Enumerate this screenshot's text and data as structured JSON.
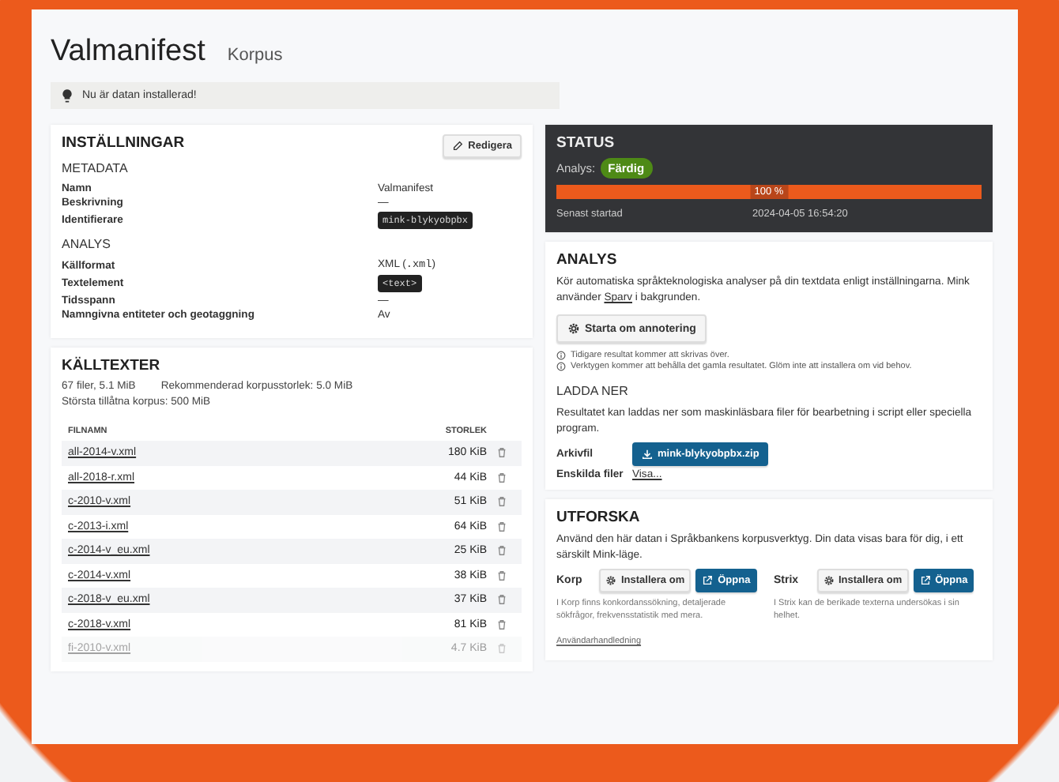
{
  "page": {
    "title": "Valmanifest",
    "subtitle": "Korpus"
  },
  "notice": "Nu är datan installerad!",
  "settings": {
    "title": "INSTÄLLNINGAR",
    "edit_button": "Redigera",
    "sections": [
      {
        "heading": "METADATA",
        "rows": [
          {
            "label": "Namn",
            "parts": [
              {
                "kind": "text",
                "text": "Valmanifest"
              }
            ]
          },
          {
            "label": "Beskrivning",
            "parts": [
              {
                "kind": "text",
                "text": "—"
              }
            ]
          },
          {
            "label": "Identifierare",
            "parts": [
              {
                "kind": "tag",
                "text": "mink-blykyobpbx"
              }
            ]
          }
        ]
      },
      {
        "heading": "ANALYS",
        "rows": [
          {
            "label": "Källformat",
            "parts": [
              {
                "kind": "text",
                "text": "XML ("
              },
              {
                "kind": "code",
                "text": ".xml"
              },
              {
                "kind": "text",
                "text": ")"
              }
            ]
          },
          {
            "label": "Textelement",
            "parts": [
              {
                "kind": "tag",
                "text": "<text>"
              }
            ]
          },
          {
            "label": "Tidsspann",
            "parts": [
              {
                "kind": "text",
                "text": "—"
              }
            ]
          },
          {
            "label": "Namngivna entiteter och geotaggning",
            "parts": [
              {
                "kind": "text",
                "text": "Av"
              }
            ]
          }
        ]
      }
    ]
  },
  "sources": {
    "title": "KÄLLTEXTER",
    "file_count": "67 filer, 5.1 MiB",
    "recommended": "Rekommenderad korpusstorlek: 5.0 MiB",
    "max": "Största tillåtna korpus: 500 MiB",
    "columns": [
      "FILNAMN",
      "STORLEK"
    ],
    "files": [
      {
        "name": "all-2014-v.xml",
        "size": "180 KiB"
      },
      {
        "name": "all-2018-r.xml",
        "size": "44 KiB"
      },
      {
        "name": "c-2010-v.xml",
        "size": "51 KiB"
      },
      {
        "name": "c-2013-i.xml",
        "size": "64 KiB"
      },
      {
        "name": "c-2014-v_eu.xml",
        "size": "25 KiB"
      },
      {
        "name": "c-2014-v.xml",
        "size": "38 KiB"
      },
      {
        "name": "c-2018-v_eu.xml",
        "size": "37 KiB"
      },
      {
        "name": "c-2018-v.xml",
        "size": "81 KiB"
      },
      {
        "name": "fi-2010-v.xml",
        "size": "4.7 KiB"
      }
    ]
  },
  "status": {
    "title": "STATUS",
    "analysis_label": "Analys:",
    "badge": "Färdig",
    "progress": {
      "level": 1,
      "label": "100 %"
    },
    "last_started_label": "Senast startad",
    "last_started": "2024-04-05 16:54:20"
  },
  "analysis": {
    "title": "ANALYS",
    "text_before": "Kör automatiska språkteknologiska analyser på din textdata enligt inställningarna. Mink använder ",
    "link": "Sparv",
    "text_after": " i bakgrunden.",
    "restart_button": "Starta om annotering",
    "notes": [
      "Tidigare resultat kommer att skrivas över.",
      "Verktygen kommer att behålla det gamla resultatet. Glöm inte att installera om vid behov."
    ],
    "download": {
      "heading": "LADDA NER",
      "text": "Resultatet kan laddas ner som maskinläsbara filer för bearbetning i script eller speciella program.",
      "archive_label": "Arkivfil",
      "archive_button": "mink-blykyobpbx.zip",
      "files_label": "Enskilda filer",
      "files_link": "Visa..."
    }
  },
  "explore": {
    "title": "UTFORSKA",
    "text": "Använd den här datan i Språkbankens korpusverktyg. Din data visas bara för dig, i ett särskilt Mink-läge.",
    "tools": [
      {
        "name": "Korp",
        "reinstall": "Installera om",
        "open": "Öppna",
        "description": "I Korp finns konkordanssökning, detaljerade sökfrågor, frekvensstatistik med mera.",
        "link": "Användarhandledning"
      },
      {
        "name": "Strix",
        "reinstall": "Installera om",
        "open": "Öppna",
        "description": "I Strix kan de berikade texterna undersökas i sin helhet."
      }
    ]
  }
}
